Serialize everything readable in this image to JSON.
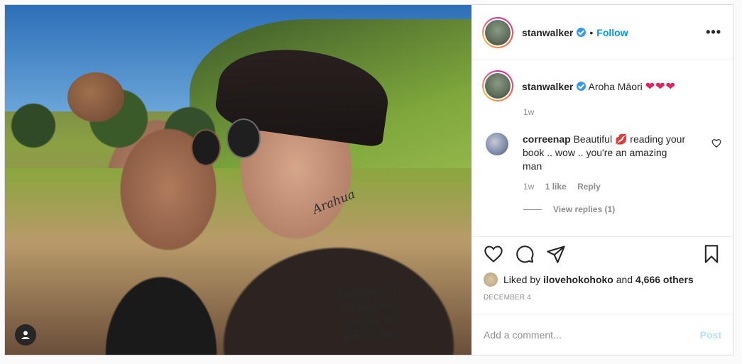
{
  "post": {
    "username": "stanwalker",
    "follow_label": "Follow",
    "dot": "•",
    "more_label": "•••",
    "caption_text": "Aroha Māori",
    "caption_hearts": "❤❤❤",
    "caption_time": "1w",
    "photo_tattoo_neck": "Arahua",
    "photo_tattoo_chest": [
      "Kuranga ki",
      "whakahoki",
      "ki a koe ko",
      "hoki e aha"
    ]
  },
  "comment": {
    "username": "correenap",
    "text_before": "Beautiful",
    "emoji": "💋",
    "text_after": "reading your book .. wow .. you're an amazing man",
    "time": "1w",
    "likes": "1 like",
    "reply_label": "Reply",
    "view_replies": "View replies (1)"
  },
  "likes": {
    "prefix": "Liked by",
    "liker": "ilovehokohoko",
    "conjunction": "and",
    "others": "4,666 others"
  },
  "date": "DECEMBER 4",
  "add_comment": {
    "placeholder": "Add a comment...",
    "post_label": "Post"
  },
  "icons": [
    "heart-icon",
    "comment-icon",
    "share-icon",
    "bookmark-icon",
    "user-tag-icon",
    "verified-badge-icon",
    "more-options-icon"
  ],
  "colors": {
    "link": "#0095f6",
    "verified": "#3897f0",
    "heart": "#e0245e",
    "muted": "#8e8e8e",
    "post_disabled": "#b2dffc"
  }
}
